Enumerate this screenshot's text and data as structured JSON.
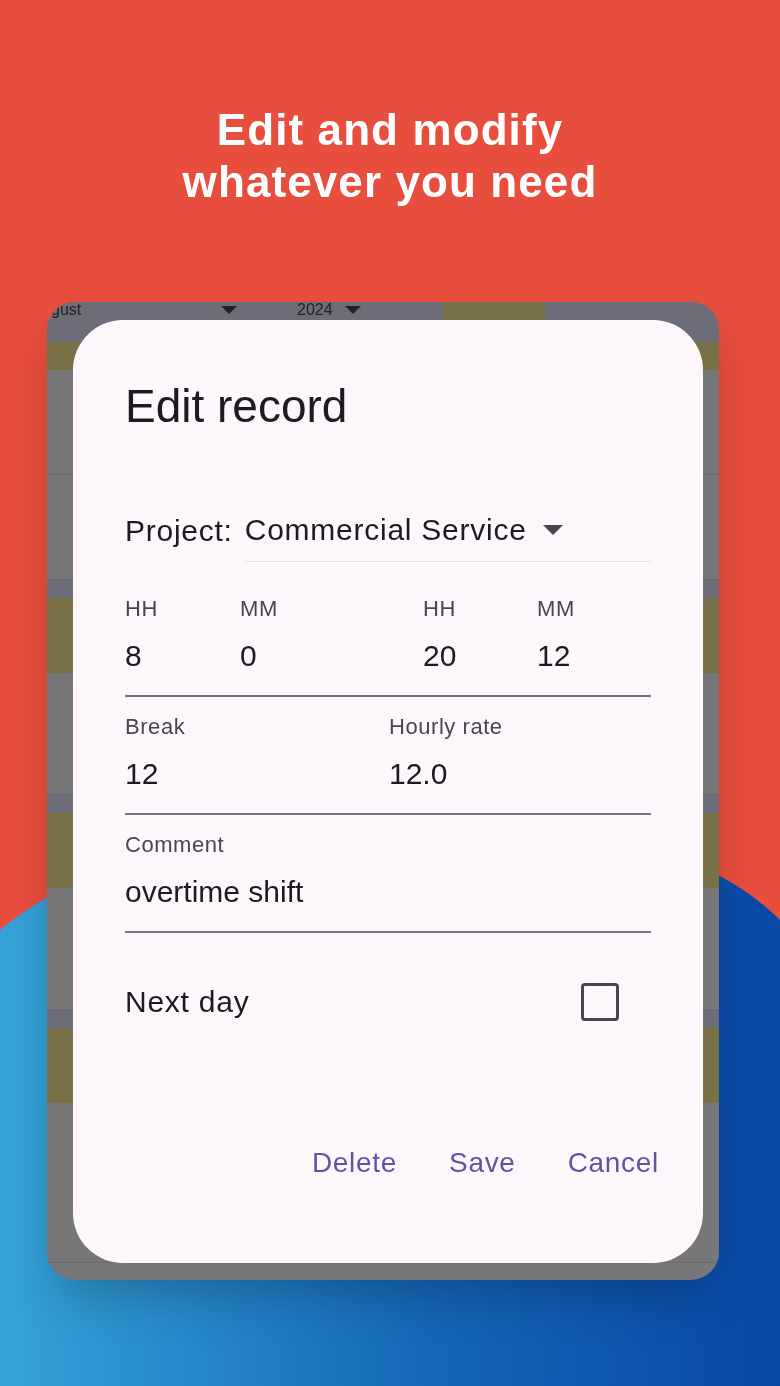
{
  "headline": [
    "Edit and modify",
    "whatever you need"
  ],
  "background_app": {
    "month": "gust",
    "year": "2024"
  },
  "dialog": {
    "title": "Edit record",
    "project": {
      "label": "Project:",
      "value": "Commercial Service"
    },
    "start": {
      "hours_label": "HH",
      "hours": "8",
      "minutes_label": "MM",
      "minutes": "0"
    },
    "end": {
      "hours_label": "HH",
      "hours": "20",
      "minutes_label": "MM",
      "minutes": "12"
    },
    "break": {
      "label": "Break",
      "value": "12"
    },
    "hourly_rate": {
      "label": "Hourly rate",
      "value": "12.0"
    },
    "comment": {
      "label": "Comment",
      "value": "overtime shift"
    },
    "next_day": {
      "label": "Next day",
      "checked": false
    },
    "buttons": [
      "Delete",
      "Save",
      "Cancel"
    ]
  }
}
